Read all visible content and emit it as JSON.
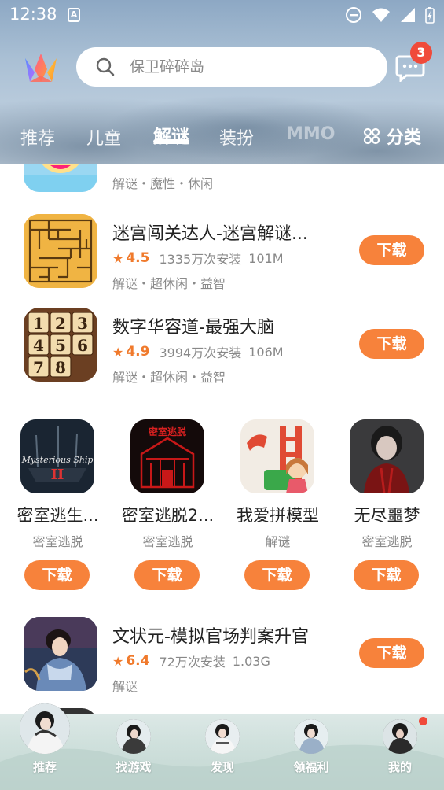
{
  "status_bar": {
    "time": "12:38",
    "a_icon": "A"
  },
  "header": {
    "search_placeholder": "保卫碎碎岛",
    "message_badge": "3",
    "tabs": [
      {
        "label": "推荐"
      },
      {
        "label": "儿童"
      },
      {
        "label": "解谜",
        "active": true
      },
      {
        "label": "装扮"
      },
      {
        "label": "MMO"
      }
    ],
    "category_label": "分类"
  },
  "list_top": [
    {
      "tags": "解谜・魔性・休闲"
    },
    {
      "name": "迷宫闯关达人-迷宫解谜...",
      "rating": "4.5",
      "installs": "1335万次安装",
      "size": "101M",
      "tags": "解谜・超休闲・益智",
      "button": "下载"
    },
    {
      "name": "数字华容道-最强大脑",
      "rating": "4.9",
      "installs": "3994万次安装",
      "size": "106M",
      "tags": "解谜・超休闲・益智",
      "button": "下载"
    }
  ],
  "puzzle_numbers": [
    "1",
    "2",
    "3",
    "4",
    "5",
    "6",
    "7",
    "8"
  ],
  "grid": [
    {
      "name": "密室逃生...",
      "tag": "密室逃脱",
      "button": "下载",
      "icon_text": "Mysterious Ship",
      "icon_sub": "II"
    },
    {
      "name": "密室逃脱2...",
      "tag": "密室逃脱",
      "button": "下载",
      "icon_text": "密室逃脱"
    },
    {
      "name": "我爱拼模型",
      "tag": "解谜",
      "button": "下载"
    },
    {
      "name": "无尽噩梦",
      "tag": "密室逃脱",
      "button": "下载"
    }
  ],
  "list_bottom": [
    {
      "name": "文状元-模拟官场判案升官",
      "rating": "6.4",
      "installs": "72万次安装",
      "size": "1.03G",
      "tags": "解谜",
      "button": "下载"
    }
  ],
  "bottom_nav": [
    {
      "label": "推荐",
      "active": true
    },
    {
      "label": "找游戏"
    },
    {
      "label": "发现"
    },
    {
      "label": "领福利"
    },
    {
      "label": "我的"
    }
  ],
  "colors": {
    "accent": "#f7823b",
    "rating": "#f07a2c",
    "badge": "#f04a3a"
  }
}
